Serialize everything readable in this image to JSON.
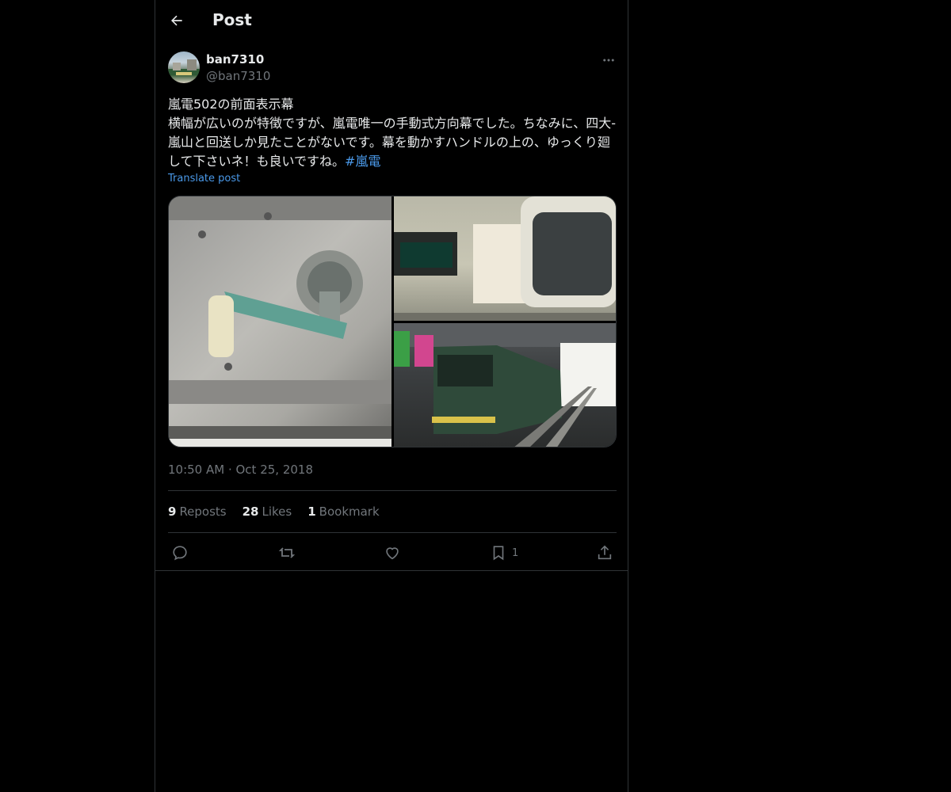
{
  "header": {
    "title": "Post"
  },
  "author": {
    "display_name": "ban7310",
    "handle": "@ban7310"
  },
  "post": {
    "text": "嵐電502の前面表示幕\n横幅が広いのが特徴ですが、嵐電唯一の手動式方向幕でした。ちなみに、四大-嵐山と回送しか見たことがないです。幕を動かすハンドルの上の、ゆっくり廻して下さいネ！も良いですね。",
    "hashtag": "#嵐電",
    "translate_label": "Translate post",
    "timestamp": "10:50 AM · Oct 25, 2018"
  },
  "stats": {
    "reposts": {
      "count": "9",
      "label": "Reposts"
    },
    "likes": {
      "count": "28",
      "label": "Likes"
    },
    "bookmarks": {
      "count": "1",
      "label": "Bookmark"
    }
  },
  "actions": {
    "bookmark_count": "1"
  },
  "colors": {
    "background": "#000000",
    "text": "#e7e9ea",
    "muted": "#71767b",
    "link": "#4a99e9",
    "border": "#2f3336"
  },
  "icons": [
    "back-arrow-icon",
    "more-icon",
    "reply-icon",
    "repost-icon",
    "like-icon",
    "bookmark-icon",
    "share-icon"
  ]
}
